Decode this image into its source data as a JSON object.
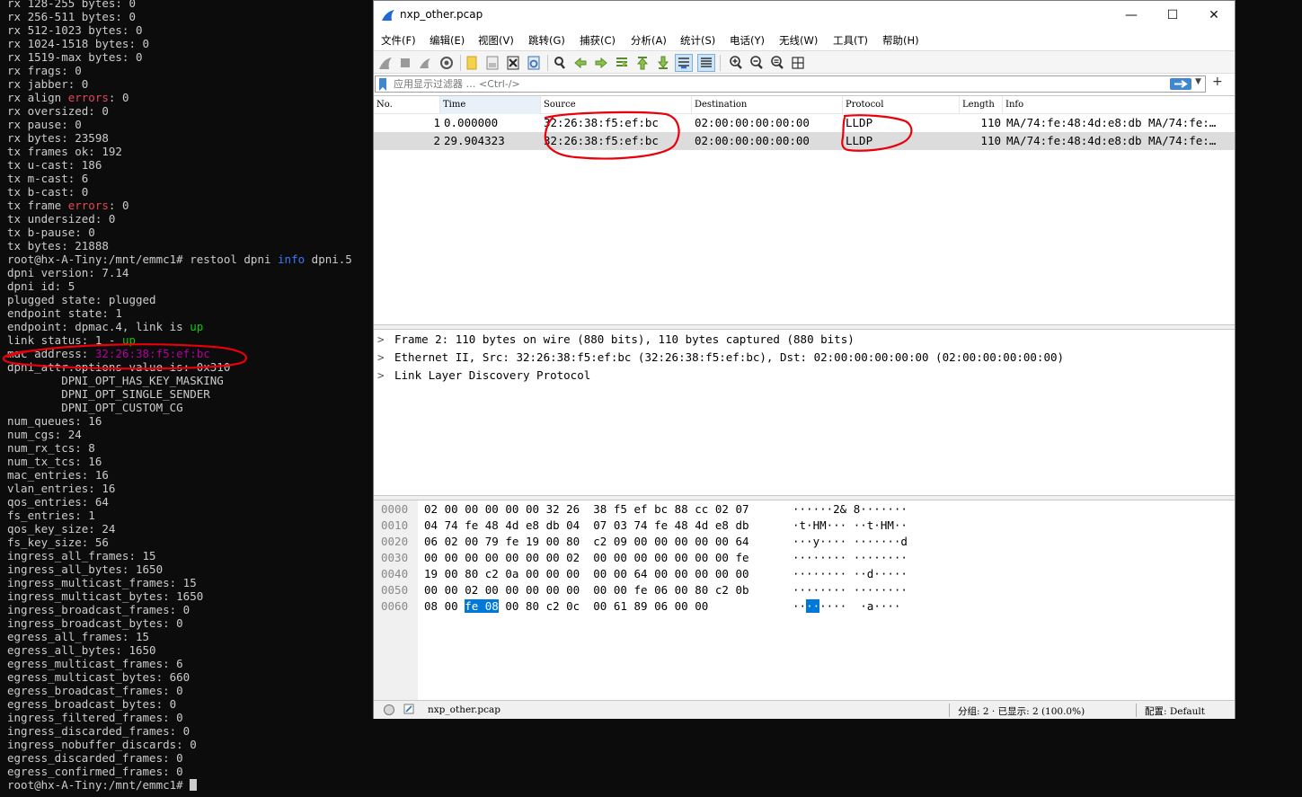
{
  "terminal": {
    "lines": [
      [
        {
          "t": "rx 128-255 bytes: 0"
        }
      ],
      [
        {
          "t": "rx 256-511 bytes: 0"
        }
      ],
      [
        {
          "t": "rx 512-1023 bytes: 0"
        }
      ],
      [
        {
          "t": "rx 1024-1518 bytes: 0"
        }
      ],
      [
        {
          "t": "rx 1519-max bytes: 0"
        }
      ],
      [
        {
          "t": "rx frags: 0"
        }
      ],
      [
        {
          "t": "rx jabber: 0"
        }
      ],
      [
        {
          "t": "rx align "
        },
        {
          "t": "errors",
          "c": "err"
        },
        {
          "t": ": 0"
        }
      ],
      [
        {
          "t": "rx oversized: 0"
        }
      ],
      [
        {
          "t": "rx pause: 0"
        }
      ],
      [
        {
          "t": "rx bytes: 23598"
        }
      ],
      [
        {
          "t": "tx frames ok: 192"
        }
      ],
      [
        {
          "t": "tx u-cast: 186"
        }
      ],
      [
        {
          "t": "tx m-cast: 6"
        }
      ],
      [
        {
          "t": "tx b-cast: 0"
        }
      ],
      [
        {
          "t": "tx frame "
        },
        {
          "t": "errors",
          "c": "err"
        },
        {
          "t": ": 0"
        }
      ],
      [
        {
          "t": "tx undersized: 0"
        }
      ],
      [
        {
          "t": "tx b-pause: 0"
        }
      ],
      [
        {
          "t": "tx bytes: 21888"
        }
      ],
      [
        {
          "t": "root@hx-A-Tiny:/mnt/emmc1# restool dpni "
        },
        {
          "t": "info",
          "c": "info"
        },
        {
          "t": " dpni.5"
        }
      ],
      [
        {
          "t": "dpni version: 7.14"
        }
      ],
      [
        {
          "t": "dpni id: 5"
        }
      ],
      [
        {
          "t": "plugged state: plugged"
        }
      ],
      [
        {
          "t": "endpoint state: 1"
        }
      ],
      [
        {
          "t": "endpoint: dpmac.4, link is "
        },
        {
          "t": "up",
          "c": "up"
        }
      ],
      [
        {
          "t": "link status: 1 - "
        },
        {
          "t": "up",
          "c": "up"
        }
      ],
      [
        {
          "t": "mac address: "
        },
        {
          "t": "32:26:38:f5:ef:bc",
          "c": "mac"
        }
      ],
      [
        {
          "t": "dpni_attr.options value is: 0x310"
        }
      ],
      [
        {
          "t": "        DPNI_OPT_HAS_KEY_MASKING"
        }
      ],
      [
        {
          "t": "        DPNI_OPT_SINGLE_SENDER"
        }
      ],
      [
        {
          "t": "        DPNI_OPT_CUSTOM_CG"
        }
      ],
      [
        {
          "t": "num_queues: 16"
        }
      ],
      [
        {
          "t": "num_cgs: 24"
        }
      ],
      [
        {
          "t": "num_rx_tcs: 8"
        }
      ],
      [
        {
          "t": "num_tx_tcs: 16"
        }
      ],
      [
        {
          "t": "mac_entries: 16"
        }
      ],
      [
        {
          "t": "vlan_entries: 16"
        }
      ],
      [
        {
          "t": "qos_entries: 64"
        }
      ],
      [
        {
          "t": "fs_entries: 1"
        }
      ],
      [
        {
          "t": "qos_key_size: 24"
        }
      ],
      [
        {
          "t": "fs_key_size: 56"
        }
      ],
      [
        {
          "t": "ingress_all_frames: 15"
        }
      ],
      [
        {
          "t": "ingress_all_bytes: 1650"
        }
      ],
      [
        {
          "t": "ingress_multicast_frames: 15"
        }
      ],
      [
        {
          "t": "ingress_multicast_bytes: 1650"
        }
      ],
      [
        {
          "t": "ingress_broadcast_frames: 0"
        }
      ],
      [
        {
          "t": "ingress_broadcast_bytes: 0"
        }
      ],
      [
        {
          "t": "egress_all_frames: 15"
        }
      ],
      [
        {
          "t": "egress_all_bytes: 1650"
        }
      ],
      [
        {
          "t": "egress_multicast_frames: 6"
        }
      ],
      [
        {
          "t": "egress_multicast_bytes: 660"
        }
      ],
      [
        {
          "t": "egress_broadcast_frames: 0"
        }
      ],
      [
        {
          "t": "egress_broadcast_bytes: 0"
        }
      ],
      [
        {
          "t": "ingress_filtered_frames: 0"
        }
      ],
      [
        {
          "t": "ingress_discarded_frames: 0"
        }
      ],
      [
        {
          "t": "ingress_nobuffer_discards: 0"
        }
      ],
      [
        {
          "t": "egress_discarded_frames: 0"
        }
      ],
      [
        {
          "t": "egress_confirmed_frames: 0"
        }
      ],
      [
        {
          "t": "root@hx-A-Tiny:/mnt/emmc1# "
        },
        {
          "cursor": true
        }
      ]
    ],
    "colors": {
      "err": "#e74856",
      "info": "#3b78ff",
      "up": "#16c60c",
      "mac": "#b4009e"
    }
  },
  "wireshark": {
    "title": "nxp_other.pcap",
    "window_buttons": [
      "—",
      "☐",
      "✕"
    ],
    "menu": [
      "文件(F)",
      "编辑(E)",
      "视图(V)",
      "跳转(G)",
      "捕获(C)",
      "分析(A)",
      "统计(S)",
      "电话(Y)",
      "无线(W)",
      "工具(T)",
      "帮助(H)"
    ],
    "toolbar_icons": [
      "start-capture-icon",
      "stop-capture-icon",
      "restart-capture-icon",
      "capture-options-icon",
      "open-file-icon",
      "save-file-icon",
      "close-file-icon",
      "reload-file-icon",
      "find-packet-icon",
      "go-back-icon",
      "go-forward-icon",
      "go-to-packet-icon",
      "go-first-icon",
      "go-last-icon",
      "autoscroll-icon",
      "colorize-icon",
      "zoom-in-icon",
      "zoom-out-icon",
      "zoom-reset-icon",
      "resize-columns-icon"
    ],
    "filter": {
      "placeholder": "应用显示过滤器 … <Ctrl-/>",
      "add_label": "+"
    },
    "columns": [
      "No.",
      "Time",
      "Source",
      "Destination",
      "Protocol",
      "Length",
      "Info"
    ],
    "packets": [
      {
        "no": "1",
        "time": "0.000000",
        "source": "32:26:38:f5:ef:bc",
        "destination": "02:00:00:00:00:00",
        "protocol": "LLDP",
        "length": "110",
        "info": "MA/74:fe:48:4d:e8:db MA/74:fe:…",
        "selected": false
      },
      {
        "no": "2",
        "time": "29.904323",
        "source": "32:26:38:f5:ef:bc",
        "destination": "02:00:00:00:00:00",
        "protocol": "LLDP",
        "length": "110",
        "info": "MA/74:fe:48:4d:e8:db MA/74:fe:…",
        "selected": true
      }
    ],
    "details": [
      {
        "chevron": ">",
        "text": "Frame 2: 110 bytes on wire (880 bits), 110 bytes captured (880 bits)"
      },
      {
        "chevron": ">",
        "text": "Ethernet II, Src: 32:26:38:f5:ef:bc (32:26:38:f5:ef:bc), Dst: 02:00:00:00:00:00 (02:00:00:00:00:00)"
      },
      {
        "chevron": ">",
        "text": "Link Layer Discovery Protocol"
      }
    ],
    "bytes": [
      {
        "offset": "0000",
        "hex": [
          "02",
          "00",
          "00",
          "00",
          "00",
          "00",
          "32",
          "26",
          "38",
          "f5",
          "ef",
          "bc",
          "88",
          "cc",
          "02",
          "07"
        ],
        "ascii": "······2& 8·······"
      },
      {
        "offset": "0010",
        "hex": [
          "04",
          "74",
          "fe",
          "48",
          "4d",
          "e8",
          "db",
          "04",
          "07",
          "03",
          "74",
          "fe",
          "48",
          "4d",
          "e8",
          "db"
        ],
        "ascii": "·t·HM··· ··t·HM··"
      },
      {
        "offset": "0020",
        "hex": [
          "06",
          "02",
          "00",
          "79",
          "fe",
          "19",
          "00",
          "80",
          "c2",
          "09",
          "00",
          "00",
          "00",
          "00",
          "00",
          "64"
        ],
        "ascii": "···y···· ·······d"
      },
      {
        "offset": "0030",
        "hex": [
          "00",
          "00",
          "00",
          "00",
          "00",
          "00",
          "00",
          "02",
          "00",
          "00",
          "00",
          "00",
          "00",
          "00",
          "00",
          "fe"
        ],
        "ascii": "········ ········"
      },
      {
        "offset": "0040",
        "hex": [
          "19",
          "00",
          "80",
          "c2",
          "0a",
          "00",
          "00",
          "00",
          "00",
          "00",
          "64",
          "00",
          "00",
          "00",
          "00",
          "00"
        ],
        "ascii": "········ ··d·····"
      },
      {
        "offset": "0050",
        "hex": [
          "00",
          "00",
          "02",
          "00",
          "00",
          "00",
          "00",
          "00",
          "00",
          "00",
          "fe",
          "06",
          "00",
          "80",
          "c2",
          "0b"
        ],
        "ascii": "········ ········"
      },
      {
        "offset": "0060",
        "hex": [
          "08",
          "00",
          "fe",
          "08",
          "00",
          "80",
          "c2",
          "0c",
          "00",
          "61",
          "89",
          "06",
          "00",
          "00"
        ],
        "ascii_pre": "··",
        "ascii_hl": "··",
        "ascii_post": "····  ·a····",
        "hl_from": 2,
        "hl_to": 3
      }
    ],
    "status": {
      "file": "nxp_other.pcap",
      "packets": "分组: 2 · 已显示: 2 (100.0%)",
      "profile": "配置: Default"
    },
    "colors": {
      "selected_row": "#dcdcdc",
      "highlight": "#0078d7",
      "annotation": "#e8000b"
    }
  }
}
